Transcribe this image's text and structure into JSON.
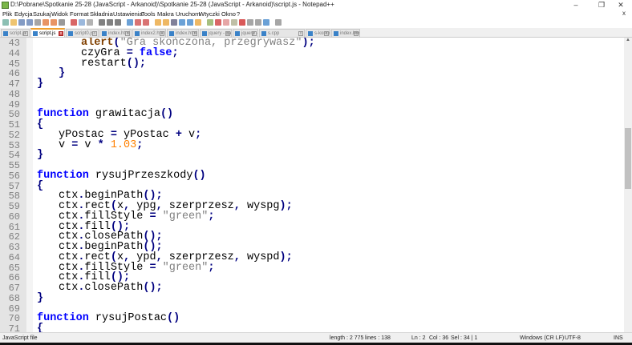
{
  "window": {
    "title": "D:\\Pobrane\\Spotkanie 25-28 (JavaScript - Arkanoid)\\Spotkanie 25-28 (JavaScript - Arkanoid)\\script.js - Notepad++",
    "minimize": "–",
    "maximize": "❐",
    "close": "✕",
    "doc_close": "x"
  },
  "menu": [
    "Plik",
    "Edycja",
    "Szukaj",
    "Widok",
    "Format",
    "Składnia",
    "Ustawienia",
    "Tools",
    "Makra",
    "Uruchom",
    "Wtyczki",
    "Okno",
    "?"
  ],
  "tabs": [
    {
      "label": "script.js",
      "active": false
    },
    {
      "label": "script.js",
      "active": true
    },
    {
      "label": "script0.js",
      "active": false
    },
    {
      "label": "index.html",
      "active": false
    },
    {
      "label": "index2.html",
      "active": false
    },
    {
      "label": "index.html",
      "active": false
    },
    {
      "label": "jquery - galeria.html",
      "active": false
    },
    {
      "label": "jquery - galeria -- baza.html",
      "active": false
    },
    {
      "label": "s.cpp",
      "active": false
    },
    {
      "label": "s-koncowy.cpp",
      "active": false
    },
    {
      "label": "index.html",
      "active": false
    }
  ],
  "code": [
    {
      "n": "43",
      "i": 2,
      "t": [
        [
          "fn",
          "alert"
        ],
        [
          "op",
          "("
        ],
        [
          "str",
          "\"Gra skończona, przegrywasz\""
        ],
        [
          "op",
          ");"
        ]
      ]
    },
    {
      "n": "44",
      "i": 2,
      "t": [
        [
          "",
          "czyGra "
        ],
        [
          "op",
          "="
        ],
        [
          "",
          ""
        ],
        [
          "kw",
          " false"
        ],
        [
          "op",
          ";"
        ]
      ]
    },
    {
      "n": "45",
      "i": 2,
      "t": [
        [
          "",
          "restart"
        ],
        [
          "op",
          "();"
        ]
      ]
    },
    {
      "n": "46",
      "i": 1,
      "t": [
        [
          "op",
          "}"
        ]
      ]
    },
    {
      "n": "47",
      "i": 0,
      "t": [
        [
          "op",
          "}"
        ]
      ]
    },
    {
      "n": "48",
      "i": 0,
      "t": []
    },
    {
      "n": "49",
      "i": 0,
      "t": []
    },
    {
      "n": "50",
      "i": 0,
      "t": [
        [
          "kw",
          "function"
        ],
        [
          "",
          " grawitacja"
        ],
        [
          "op",
          "()"
        ]
      ]
    },
    {
      "n": "51",
      "i": 0,
      "t": [
        [
          "op",
          "{"
        ]
      ]
    },
    {
      "n": "52",
      "i": 1,
      "t": [
        [
          "",
          "yPostac "
        ],
        [
          "op",
          "="
        ],
        [
          "",
          " yPostac "
        ],
        [
          "op",
          "+"
        ],
        [
          "",
          " v"
        ],
        [
          "op",
          ";"
        ]
      ]
    },
    {
      "n": "53",
      "i": 1,
      "t": [
        [
          "",
          "v "
        ],
        [
          "op",
          "="
        ],
        [
          "",
          " v "
        ],
        [
          "op",
          "*"
        ],
        [
          "num",
          " 1.03"
        ],
        [
          "op",
          ";"
        ]
      ]
    },
    {
      "n": "54",
      "i": 0,
      "t": [
        [
          "op",
          "}"
        ]
      ]
    },
    {
      "n": "55",
      "i": 0,
      "t": []
    },
    {
      "n": "56",
      "i": 0,
      "t": [
        [
          "kw",
          "function"
        ],
        [
          "",
          " rysujPrzeszkody"
        ],
        [
          "op",
          "()"
        ]
      ]
    },
    {
      "n": "57",
      "i": 0,
      "t": [
        [
          "op",
          "{"
        ]
      ]
    },
    {
      "n": "58",
      "i": 1,
      "t": [
        [
          "",
          "ctx"
        ],
        [
          "op",
          "."
        ],
        [
          "",
          "beginPath"
        ],
        [
          "op",
          "();"
        ]
      ]
    },
    {
      "n": "59",
      "i": 1,
      "t": [
        [
          "",
          "ctx"
        ],
        [
          "op",
          "."
        ],
        [
          "",
          "rect"
        ],
        [
          "op",
          "("
        ],
        [
          "",
          "x"
        ],
        [
          "op",
          ","
        ],
        [
          "",
          " ypg"
        ],
        [
          "op",
          ","
        ],
        [
          "",
          " szerprzesz"
        ],
        [
          "op",
          ","
        ],
        [
          "",
          " wyspg"
        ],
        [
          "op",
          ");"
        ]
      ]
    },
    {
      "n": "60",
      "i": 1,
      "t": [
        [
          "",
          "ctx"
        ],
        [
          "op",
          "."
        ],
        [
          "",
          "fillStyle "
        ],
        [
          "op",
          "="
        ],
        [
          "str",
          " \"green\""
        ],
        [
          "op",
          ";"
        ]
      ]
    },
    {
      "n": "61",
      "i": 1,
      "t": [
        [
          "",
          "ctx"
        ],
        [
          "op",
          "."
        ],
        [
          "",
          "fill"
        ],
        [
          "op",
          "();"
        ]
      ]
    },
    {
      "n": "62",
      "i": 1,
      "t": [
        [
          "",
          "ctx"
        ],
        [
          "op",
          "."
        ],
        [
          "",
          "closePath"
        ],
        [
          "op",
          "();"
        ]
      ]
    },
    {
      "n": "63",
      "i": 1,
      "t": [
        [
          "",
          "ctx"
        ],
        [
          "op",
          "."
        ],
        [
          "",
          "beginPath"
        ],
        [
          "op",
          "();"
        ]
      ]
    },
    {
      "n": "64",
      "i": 1,
      "t": [
        [
          "",
          "ctx"
        ],
        [
          "op",
          "."
        ],
        [
          "",
          "rect"
        ],
        [
          "op",
          "("
        ],
        [
          "",
          "x"
        ],
        [
          "op",
          ","
        ],
        [
          "",
          " ypd"
        ],
        [
          "op",
          ","
        ],
        [
          "",
          " szerprzesz"
        ],
        [
          "op",
          ","
        ],
        [
          "",
          " wyspd"
        ],
        [
          "op",
          ");"
        ]
      ]
    },
    {
      "n": "65",
      "i": 1,
      "t": [
        [
          "",
          "ctx"
        ],
        [
          "op",
          "."
        ],
        [
          "",
          "fillStyle "
        ],
        [
          "op",
          "="
        ],
        [
          "str",
          " \"green\""
        ],
        [
          "op",
          ";"
        ]
      ]
    },
    {
      "n": "66",
      "i": 1,
      "t": [
        [
          "",
          "ctx"
        ],
        [
          "op",
          "."
        ],
        [
          "",
          "fill"
        ],
        [
          "op",
          "();"
        ]
      ]
    },
    {
      "n": "67",
      "i": 1,
      "t": [
        [
          "",
          "ctx"
        ],
        [
          "op",
          "."
        ],
        [
          "",
          "closePath"
        ],
        [
          "op",
          "();"
        ]
      ]
    },
    {
      "n": "68",
      "i": 0,
      "t": [
        [
          "op",
          "}"
        ]
      ]
    },
    {
      "n": "69",
      "i": 0,
      "t": []
    },
    {
      "n": "70",
      "i": 0,
      "t": [
        [
          "kw",
          "function"
        ],
        [
          "",
          " rysujPostac"
        ],
        [
          "op",
          "()"
        ]
      ]
    },
    {
      "n": "71",
      "i": 0,
      "t": [
        [
          "op",
          "{"
        ]
      ]
    }
  ],
  "status": {
    "filetype": "JavaScript file",
    "length": "length : 2 775",
    "lines": "lines : 138",
    "ln": "Ln : 2",
    "col": "Col : 36",
    "sel": "Sel : 34 | 1",
    "eol": "Windows (CR LF)",
    "encoding": "UTF-8",
    "mode": "INS"
  },
  "scroll": {
    "position_fraction": 0.32
  }
}
